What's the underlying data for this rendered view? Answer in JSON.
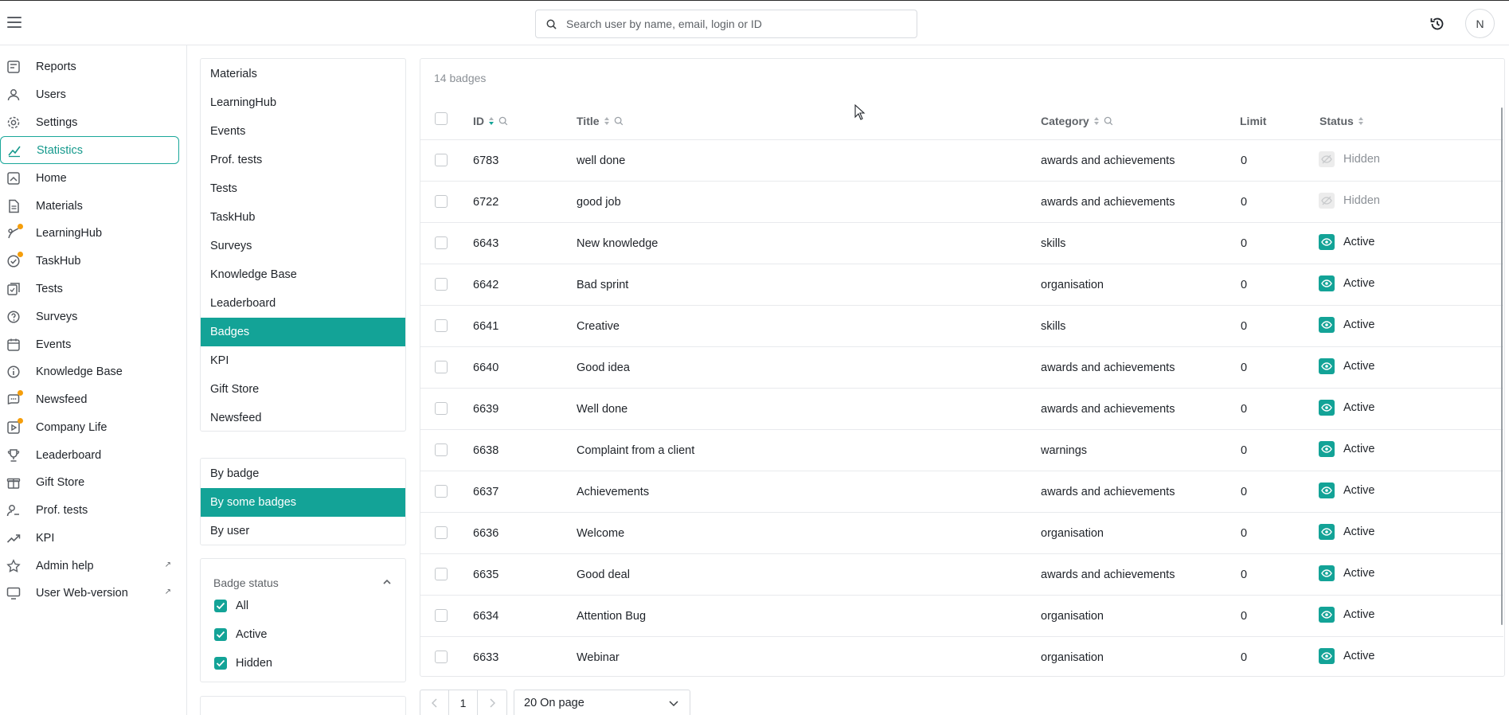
{
  "header": {
    "search_placeholder": "Search user by name, email, login or ID",
    "avatar_initial": "N"
  },
  "sidebar": {
    "items": [
      {
        "label": "Reports",
        "icon": "reports-icon"
      },
      {
        "label": "Users",
        "icon": "users-icon"
      },
      {
        "label": "Settings",
        "icon": "gear-icon"
      },
      {
        "label": "Statistics",
        "icon": "chart-line-icon",
        "active": true
      },
      {
        "label": "Home",
        "icon": "home-icon"
      },
      {
        "label": "Materials",
        "icon": "document-icon"
      },
      {
        "label": "LearningHub",
        "icon": "learninghub-icon",
        "dot": true
      },
      {
        "label": "TaskHub",
        "icon": "taskhub-icon",
        "dot": true
      },
      {
        "label": "Tests",
        "icon": "tests-icon"
      },
      {
        "label": "Surveys",
        "icon": "survey-icon"
      },
      {
        "label": "Events",
        "icon": "calendar-icon"
      },
      {
        "label": "Knowledge Base",
        "icon": "info-icon"
      },
      {
        "label": "Newsfeed",
        "icon": "newsfeed-icon",
        "dot": true
      },
      {
        "label": "Company Life",
        "icon": "company-life-icon",
        "dot": true
      },
      {
        "label": "Leaderboard",
        "icon": "trophy-icon"
      },
      {
        "label": "Gift Store",
        "icon": "gift-icon"
      },
      {
        "label": "Prof. tests",
        "icon": "prof-tests-icon"
      },
      {
        "label": "KPI",
        "icon": "trend-icon"
      },
      {
        "label": "Admin help",
        "icon": "star-icon",
        "external": true
      },
      {
        "label": "User Web-version",
        "icon": "monitor-icon",
        "external": true
      }
    ]
  },
  "sections": {
    "items": [
      "Materials",
      "LearningHub",
      "Events",
      "Prof. tests",
      "Tests",
      "TaskHub",
      "Surveys",
      "Knowledge Base",
      "Leaderboard",
      "Badges",
      "KPI",
      "Gift Store",
      "Newsfeed"
    ],
    "selected": "Badges"
  },
  "report_types": {
    "items": [
      "By badge",
      "By some badges",
      "By user"
    ],
    "selected": "By some badges"
  },
  "badge_status_filter": {
    "title": "Badge status",
    "options": [
      {
        "label": "All",
        "checked": true
      },
      {
        "label": "Active",
        "checked": true
      },
      {
        "label": "Hidden",
        "checked": true
      }
    ]
  },
  "table": {
    "count_label": "14 badges",
    "columns": {
      "id": "ID",
      "title": "Title",
      "category": "Category",
      "limit": "Limit",
      "status": "Status"
    },
    "rows": [
      {
        "id": "6783",
        "title": "well done",
        "category": "awards and achievements",
        "limit": "0",
        "status": "Hidden"
      },
      {
        "id": "6722",
        "title": "good job",
        "category": "awards and achievements",
        "limit": "0",
        "status": "Hidden"
      },
      {
        "id": "6643",
        "title": "New knowledge",
        "category": "skills",
        "limit": "0",
        "status": "Active"
      },
      {
        "id": "6642",
        "title": "Bad sprint",
        "category": "organisation",
        "limit": "0",
        "status": "Active"
      },
      {
        "id": "6641",
        "title": "Creative",
        "category": "skills",
        "limit": "0",
        "status": "Active"
      },
      {
        "id": "6640",
        "title": "Good idea",
        "category": "awards and achievements",
        "limit": "0",
        "status": "Active"
      },
      {
        "id": "6639",
        "title": "Well done",
        "category": "awards and achievements",
        "limit": "0",
        "status": "Active"
      },
      {
        "id": "6638",
        "title": "Complaint from a client",
        "category": "warnings",
        "limit": "0",
        "status": "Active"
      },
      {
        "id": "6637",
        "title": "Achievements",
        "category": "awards and achievements",
        "limit": "0",
        "status": "Active"
      },
      {
        "id": "6636",
        "title": "Welcome",
        "category": "organisation",
        "limit": "0",
        "status": "Active"
      },
      {
        "id": "6635",
        "title": "Good deal",
        "category": "awards and achievements",
        "limit": "0",
        "status": "Active"
      },
      {
        "id": "6634",
        "title": "Attention Bug",
        "category": "organisation",
        "limit": "0",
        "status": "Active"
      },
      {
        "id": "6633",
        "title": "Webinar",
        "category": "organisation",
        "limit": "0",
        "status": "Active"
      }
    ]
  },
  "pagination": {
    "current_page": "1",
    "per_page_label": "20 On page"
  },
  "colors": {
    "accent": "#13a397",
    "notification_dot": "#f59e0b"
  }
}
